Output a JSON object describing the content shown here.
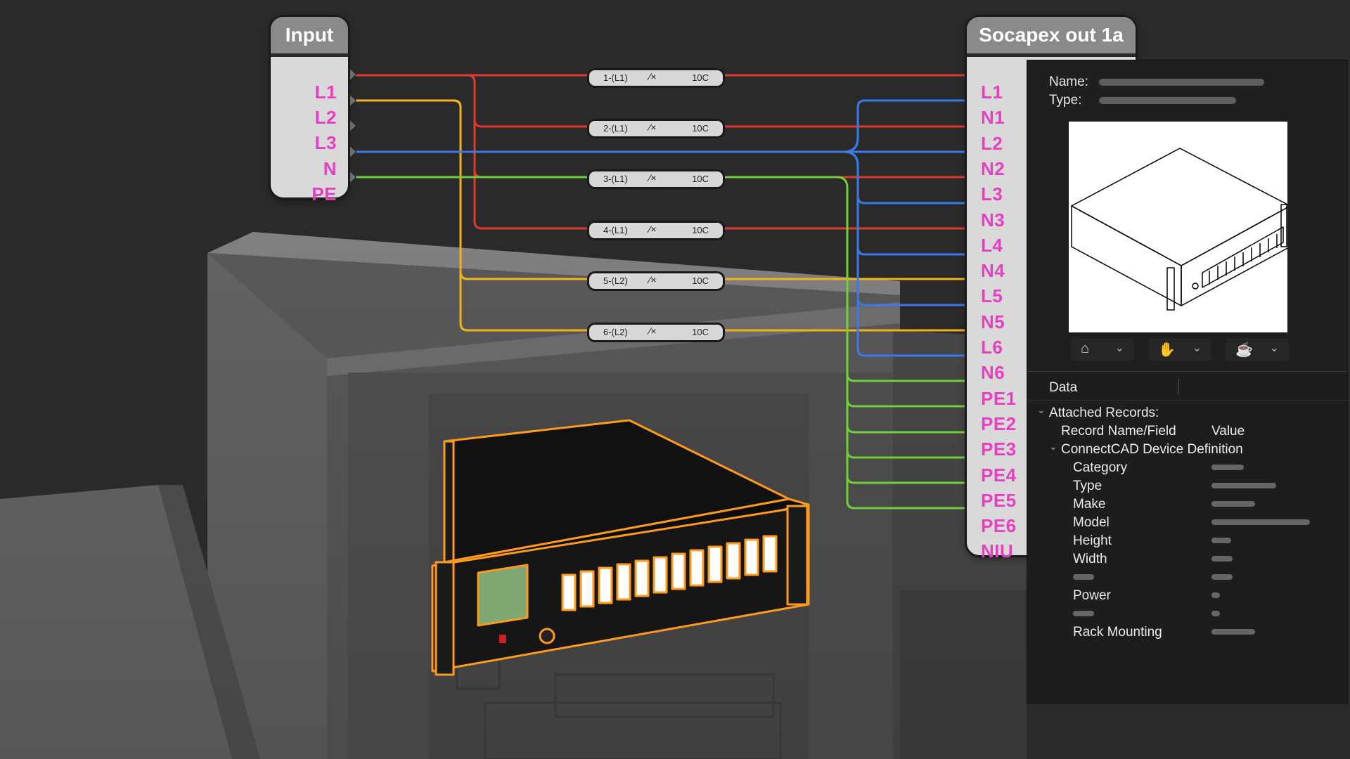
{
  "input_block": {
    "title": "Input",
    "pins": [
      "L1",
      "L2",
      "L3",
      "N",
      "PE"
    ]
  },
  "output_block": {
    "title": "Socapex out 1a",
    "pins": [
      "L1",
      "N1",
      "L2",
      "N2",
      "L3",
      "N3",
      "L4",
      "N4",
      "L5",
      "N5",
      "L6",
      "N6",
      "PE1",
      "PE2",
      "PE3",
      "PE4",
      "PE5",
      "PE6",
      "NIU"
    ]
  },
  "breakers": [
    {
      "label": "1-(L1)",
      "rating": "10C"
    },
    {
      "label": "2-(L1)",
      "rating": "10C"
    },
    {
      "label": "3-(L1)",
      "rating": "10C"
    },
    {
      "label": "4-(L1)",
      "rating": "10C"
    },
    {
      "label": "5-(L2)",
      "rating": "10C"
    },
    {
      "label": "6-(L2)",
      "rating": "10C"
    }
  ],
  "wire_colors": {
    "L1": "#e03a2f",
    "L2": "#f2b320",
    "N": "#3a7be8",
    "PE": "#6fd03a",
    "highlight": "#ff9a1f"
  },
  "panel": {
    "name_label": "Name:",
    "type_label": "Type:",
    "view_buttons": [
      "house-icon",
      "hand-icon",
      "teapot-icon"
    ],
    "data_tab": "Data",
    "attached_records": "Attached Records:",
    "col_name": "Record Name/Field",
    "col_value": "Value",
    "record_name": "ConnectCAD Device Definition",
    "fields": [
      "Category",
      "Type",
      "Make",
      "Model",
      "Height",
      "Width",
      "",
      "Power",
      "",
      "Rack Mounting"
    ]
  }
}
